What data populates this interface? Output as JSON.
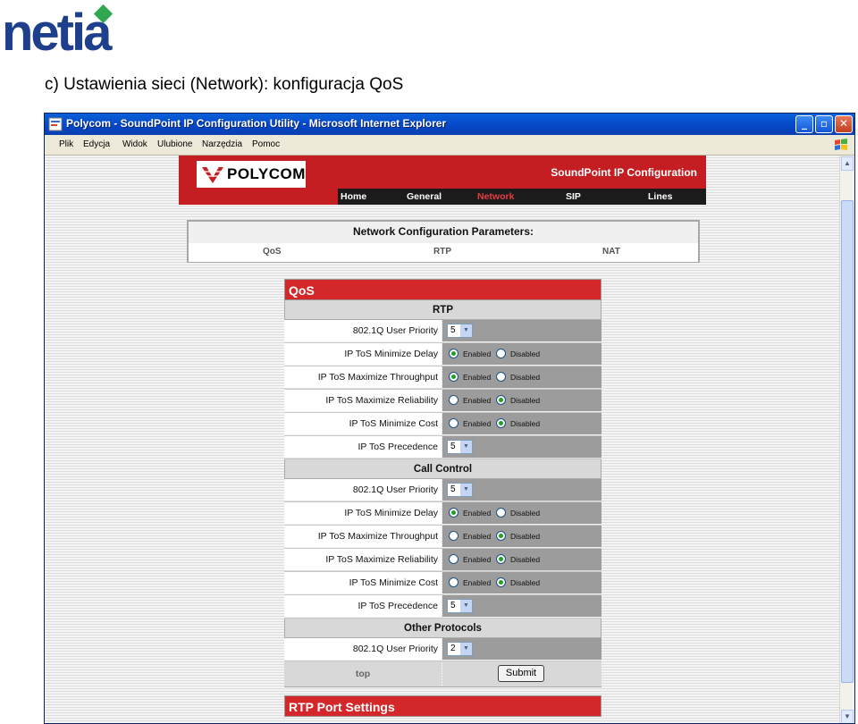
{
  "logo_text": "netia",
  "caption": "c) Ustawienia sieci (Network): konfiguracja QoS",
  "window": {
    "title": "Polycom - SoundPoint IP Configuration Utility - Microsoft Internet Explorer",
    "menu": [
      "Plik",
      "Edycja",
      "Widok",
      "Ulubione",
      "Narzędzia",
      "Pomoc"
    ]
  },
  "polycom": {
    "brand": "POLYCOM",
    "title": "SoundPoint IP Configuration",
    "nav": [
      "Home",
      "General",
      "Network",
      "SIP",
      "Lines"
    ],
    "active_nav": "Network",
    "active_color": "#e63c3c"
  },
  "ncp": {
    "title": "Network Configuration Parameters:",
    "links": [
      "QoS",
      "RTP",
      "NAT"
    ]
  },
  "qos": {
    "header": "QoS",
    "enabled_label": "Enabled",
    "disabled_label": "Disabled",
    "sections": [
      {
        "title": "RTP",
        "rows": [
          {
            "label": "802.1Q User Priority",
            "type": "select",
            "value": "5"
          },
          {
            "label": "IP ToS Minimize Delay",
            "type": "radio",
            "value": "Enabled"
          },
          {
            "label": "IP ToS Maximize Throughput",
            "type": "radio",
            "value": "Enabled"
          },
          {
            "label": "IP ToS Maximize Reliability",
            "type": "radio",
            "value": "Disabled"
          },
          {
            "label": "IP ToS Minimize Cost",
            "type": "radio",
            "value": "Disabled"
          },
          {
            "label": "IP ToS Precedence",
            "type": "select",
            "value": "5"
          }
        ]
      },
      {
        "title": "Call Control",
        "rows": [
          {
            "label": "802.1Q User Priority",
            "type": "select",
            "value": "5"
          },
          {
            "label": "IP ToS Minimize Delay",
            "type": "radio",
            "value": "Enabled"
          },
          {
            "label": "IP ToS Maximize Throughput",
            "type": "radio",
            "value": "Disabled"
          },
          {
            "label": "IP ToS Maximize Reliability",
            "type": "radio",
            "value": "Disabled"
          },
          {
            "label": "IP ToS Minimize Cost",
            "type": "radio",
            "value": "Disabled"
          },
          {
            "label": "IP ToS Precedence",
            "type": "select",
            "value": "5"
          }
        ]
      },
      {
        "title": "Other Protocols",
        "rows": [
          {
            "label": "802.1Q User Priority",
            "type": "select",
            "value": "2"
          }
        ]
      }
    ],
    "top_link": "top",
    "submit": "Submit"
  },
  "rtp_port": {
    "header": "RTP Port Settings"
  }
}
